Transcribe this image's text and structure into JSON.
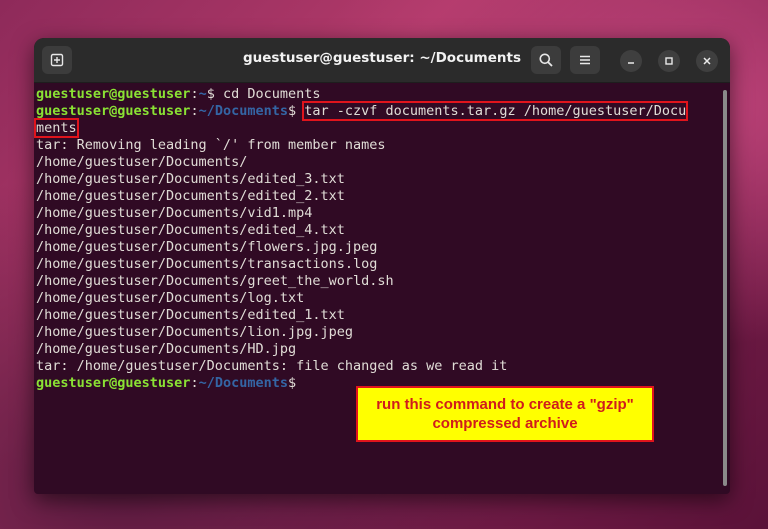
{
  "window": {
    "title": "guestuser@guestuser: ~/Documents",
    "new_tab_icon": "new-tab-icon",
    "search_icon": "search-icon",
    "menu_icon": "hamburger-menu-icon",
    "minimize_icon": "minimize-icon",
    "maximize_icon": "maximize-icon",
    "close_icon": "close-icon"
  },
  "terminal": {
    "prompt_user": "guestuser@guestuser",
    "line1": {
      "path": "~",
      "cmd": "$ cd Documents"
    },
    "line2": {
      "path": "~/Documents",
      "dollar": "$ ",
      "cmd_a": "tar -czvf documents.tar.gz /home/guestuser/Docu",
      "cmd_b": "ments"
    },
    "output": [
      "tar: Removing leading `/' from member names",
      "/home/guestuser/Documents/",
      "/home/guestuser/Documents/edited_3.txt",
      "/home/guestuser/Documents/edited_2.txt",
      "/home/guestuser/Documents/vid1.mp4",
      "/home/guestuser/Documents/edited_4.txt",
      "/home/guestuser/Documents/flowers.jpg.jpeg",
      "/home/guestuser/Documents/transactions.log",
      "/home/guestuser/Documents/greet_the_world.sh",
      "/home/guestuser/Documents/log.txt",
      "/home/guestuser/Documents/edited_1.txt",
      "/home/guestuser/Documents/lion.jpg.jpeg",
      "/home/guestuser/Documents/HD.jpg",
      "tar: /home/guestuser/Documents: file changed as we read it"
    ],
    "last_prompt": {
      "path": "~/Documents",
      "dollar": "$"
    }
  },
  "callout": {
    "line1": "run this command to create a \"gzip\"",
    "line2": "compressed archive"
  },
  "colors": {
    "terminal_bg": "#300a24",
    "user_green": "#8ae234",
    "path_blue": "#3465a4",
    "highlight_red": "#e0141c",
    "callout_yellow": "#ffff00"
  }
}
